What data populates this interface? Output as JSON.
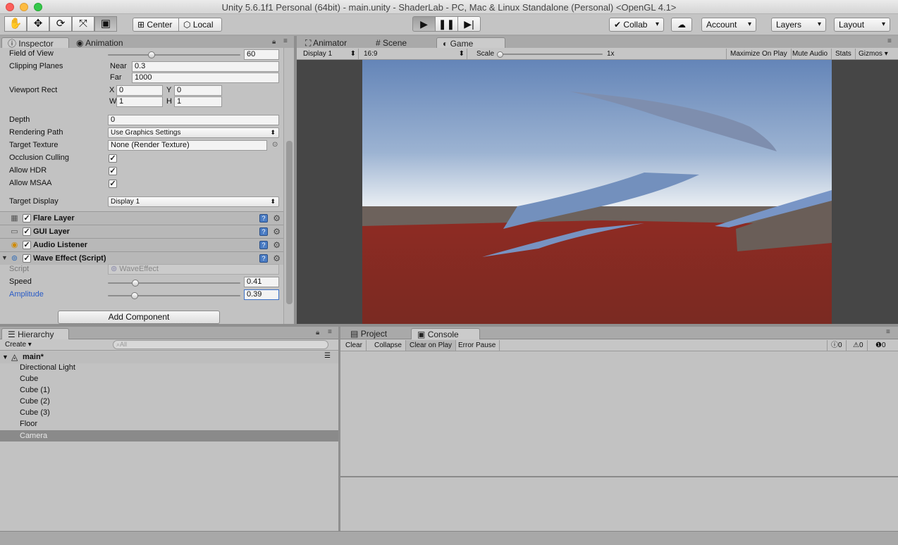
{
  "window": {
    "title": "Unity 5.6.1f1 Personal (64bit) - main.unity - ShaderLab - PC, Mac & Linux Standalone (Personal) <OpenGL 4.1>"
  },
  "toolbar": {
    "pivot_label": "Center",
    "space_label": "Local",
    "collab_label": "Collab",
    "account_label": "Account",
    "layers_label": "Layers",
    "layout_label": "Layout",
    "tools": [
      "hand-icon",
      "move-icon",
      "rotate-icon",
      "scale-icon",
      "rect-tool-icon"
    ]
  },
  "inspector": {
    "tab_label": "Inspector",
    "animation_tab_label": "Animation",
    "field_of_view": {
      "label": "Field of View",
      "value": "60",
      "slider_fraction": 0.33
    },
    "clipping_planes": {
      "label": "Clipping Planes",
      "near_label": "Near",
      "near": "0.3",
      "far_label": "Far",
      "far": "1000"
    },
    "viewport_rect": {
      "label": "Viewport Rect",
      "x_label": "X",
      "x": "0",
      "y_label": "Y",
      "y": "0",
      "w_label": "W",
      "w": "1",
      "h_label": "H",
      "h": "1"
    },
    "depth": {
      "label": "Depth",
      "value": "0"
    },
    "rendering_path": {
      "label": "Rendering Path",
      "value": "Use Graphics Settings"
    },
    "target_texture": {
      "label": "Target Texture",
      "value": "None (Render Texture)"
    },
    "occlusion_culling": {
      "label": "Occlusion Culling",
      "checked": true
    },
    "allow_hdr": {
      "label": "Allow HDR",
      "checked": true
    },
    "allow_msaa": {
      "label": "Allow MSAA",
      "checked": true
    },
    "target_display": {
      "label": "Target Display",
      "value": "Display 1"
    },
    "components": [
      {
        "name": "Flare Layer",
        "icon": "flare-layer-icon"
      },
      {
        "name": "GUI Layer",
        "icon": "gui-layer-icon"
      },
      {
        "name": "Audio Listener",
        "icon": "audio-listener-icon"
      },
      {
        "name": "Wave Effect (Script)",
        "icon": "script-icon"
      }
    ],
    "script": {
      "label": "Script",
      "value": "WaveEffect"
    },
    "speed": {
      "label": "Speed",
      "value": "0.41",
      "slider_fraction": 0.21
    },
    "amplitude": {
      "label": "Amplitude",
      "value": "0.39",
      "slider_fraction": 0.2
    },
    "add_component_label": "Add Component"
  },
  "scene_tabs": {
    "animator": "Animator",
    "scene": "Scene",
    "game": "Game"
  },
  "game_toolbar": {
    "display": "Display 1",
    "aspect": "16:9",
    "scale_label": "Scale",
    "scale_value": "1x",
    "maximize_on_play": "Maximize On Play",
    "mute_audio": "Mute Audio",
    "stats": "Stats",
    "gizmos": "Gizmos"
  },
  "hierarchy": {
    "tab_label": "Hierarchy",
    "create_label": "Create",
    "search_placeholder": "All",
    "scene_name": "main*",
    "items": [
      "Directional Light",
      "Cube",
      "Cube (1)",
      "Cube (2)",
      "Cube (3)",
      "Floor",
      "Camera"
    ],
    "selected": "Camera"
  },
  "console": {
    "project_tab": "Project",
    "console_tab": "Console",
    "clear": "Clear",
    "collapse": "Collapse",
    "clear_on_play": "Clear on Play",
    "error_pause": "Error Pause",
    "info_count": "0",
    "warning_count": "0",
    "error_count": "0"
  },
  "colors": {
    "sky_top": "#6485b8",
    "sky_horizon": "#e8edf2",
    "floor_red": "#8e2b23",
    "ground_gray": "#6d625c",
    "selection": "#8a8a8a",
    "link_blue": "#2a5cc7"
  }
}
